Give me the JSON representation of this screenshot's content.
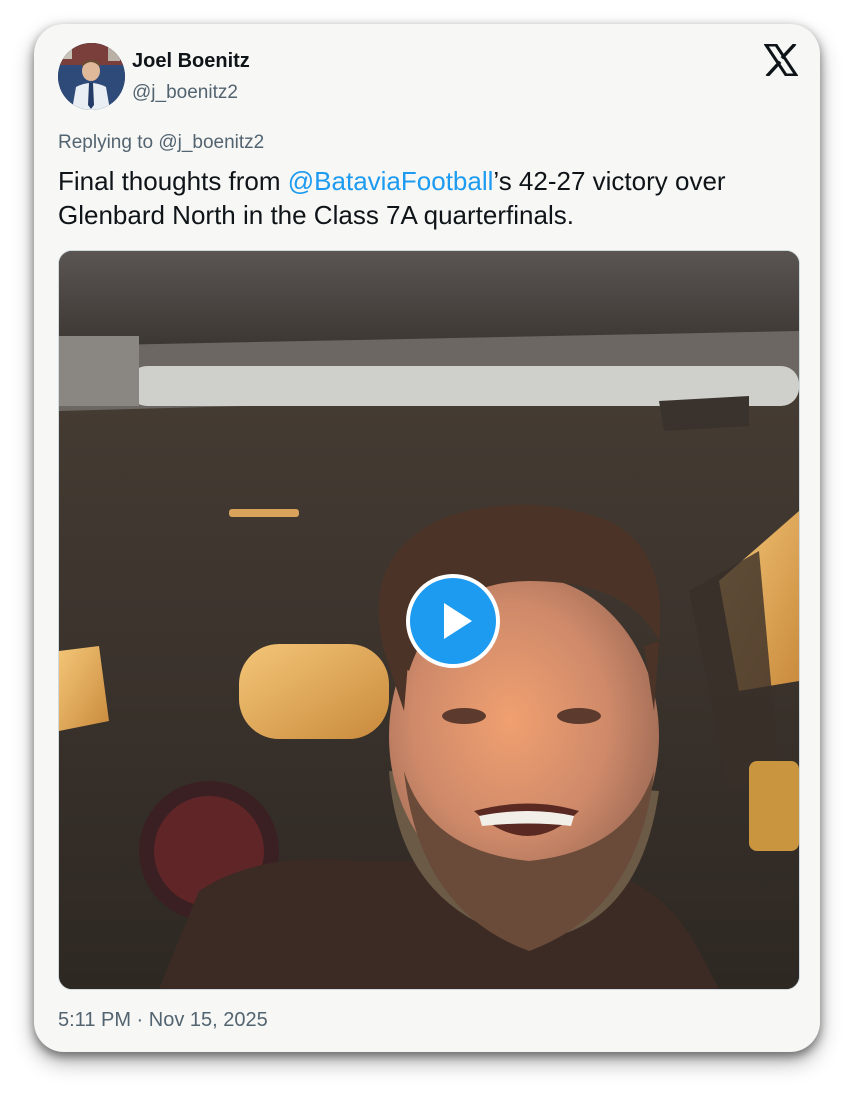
{
  "author": {
    "name": "Joel Boenitz",
    "handle": "@j_boenitz2",
    "avatar_icon": "profile-photo"
  },
  "brand_icon": "x-logo-icon",
  "reply": {
    "prefix": "Replying to ",
    "handle": "@j_boenitz2"
  },
  "tweet": {
    "text_before": "Final thoughts from ",
    "mention": "@BataviaFootball",
    "text_after": "’s 42-27 victory over Glenbard North in the Class 7A quarterfinals."
  },
  "media": {
    "type": "video",
    "play_icon": "play-icon",
    "accent_color": "#1d9bf0"
  },
  "timestamp": "5:11 PM · Nov 15, 2025"
}
